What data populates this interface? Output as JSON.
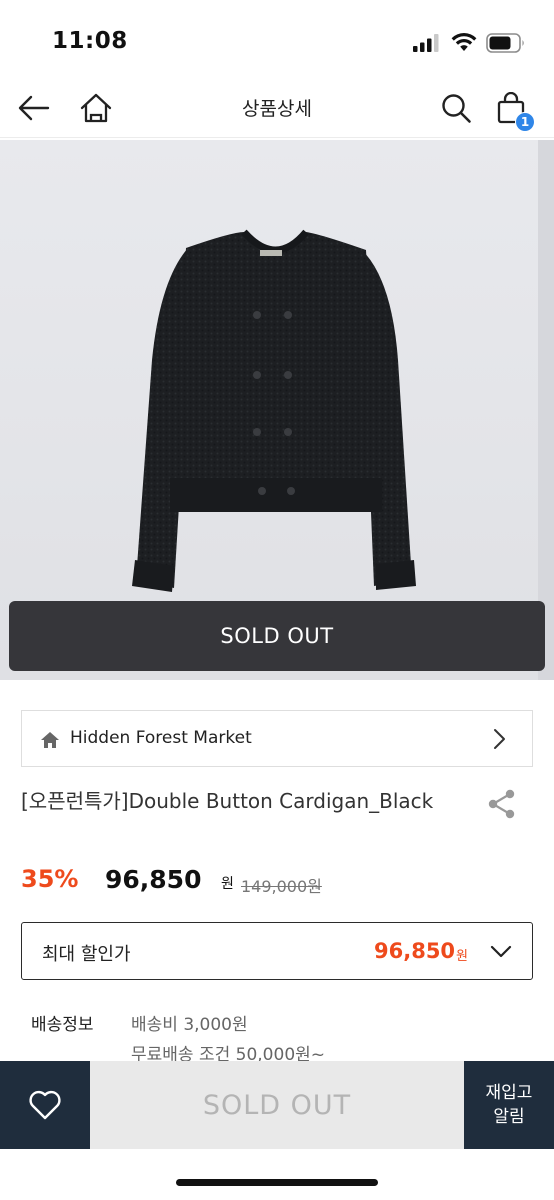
{
  "status_bar": {
    "time": "11:08"
  },
  "header": {
    "title": "상품상세",
    "cart_count": "1"
  },
  "product": {
    "sold_out_banner": "SOLD OUT",
    "store_name": "Hidden Forest Market",
    "name": "[오픈런특가]Double Button Cardigan_Black",
    "discount": "35%",
    "price": "96,850",
    "price_unit": "원",
    "original_price": "149,000원"
  },
  "max_discount": {
    "label": "최대 할인가",
    "value": "96,850",
    "unit": "원"
  },
  "shipping": {
    "label": "배송정보",
    "fee": "배송비 3,000원",
    "free_condition": "무료배송 조건 50,000원~"
  },
  "bottom_bar": {
    "sold_out": "SOLD OUT",
    "restock_line1": "재입고",
    "restock_line2": "알림"
  },
  "colors": {
    "accent": "#ee4a1c",
    "navy": "#1f2d3d",
    "badge": "#2f86e8"
  },
  "icons": [
    "back-arrow-icon",
    "home-icon",
    "search-icon",
    "shopping-bag-icon",
    "chevron-right-icon",
    "share-icon",
    "chevron-down-icon",
    "heart-icon"
  ]
}
